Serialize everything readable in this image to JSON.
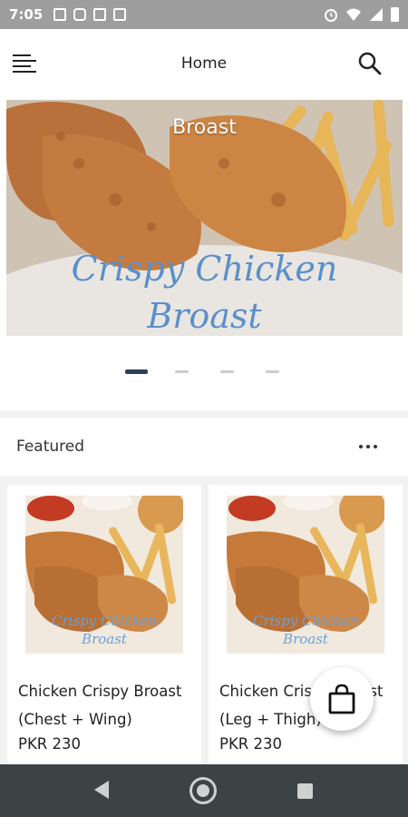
{
  "status_bar": {
    "time": "7:05"
  },
  "app_bar": {
    "title": "Home"
  },
  "banner": {
    "title": "Broast",
    "caption_line1": "Crispy Chicken",
    "caption_line2": "Broast",
    "slide_count": 4,
    "active_slide": 0
  },
  "featured": {
    "label": "Featured"
  },
  "products": [
    {
      "name": "Chicken Crispy Broast (Chest + Wing)",
      "price": "PKR 230",
      "image_caption_line1": "Crispy Chicken",
      "image_caption_line2": "Broast"
    },
    {
      "name": "Chicken Crispy Broast (Leg + Thigh)",
      "price": "PKR 230",
      "image_caption_line1": "Crispy Chicken",
      "image_caption_line2": "Broast"
    }
  ],
  "icons": {
    "menu": "menu-icon",
    "search": "search-icon",
    "more": "more-horizontal-icon",
    "cart": "shopping-bag-icon"
  },
  "colors": {
    "accent": "#2d3f55",
    "caption": "#5b8fc9",
    "nav_bar": "#3d4244"
  }
}
